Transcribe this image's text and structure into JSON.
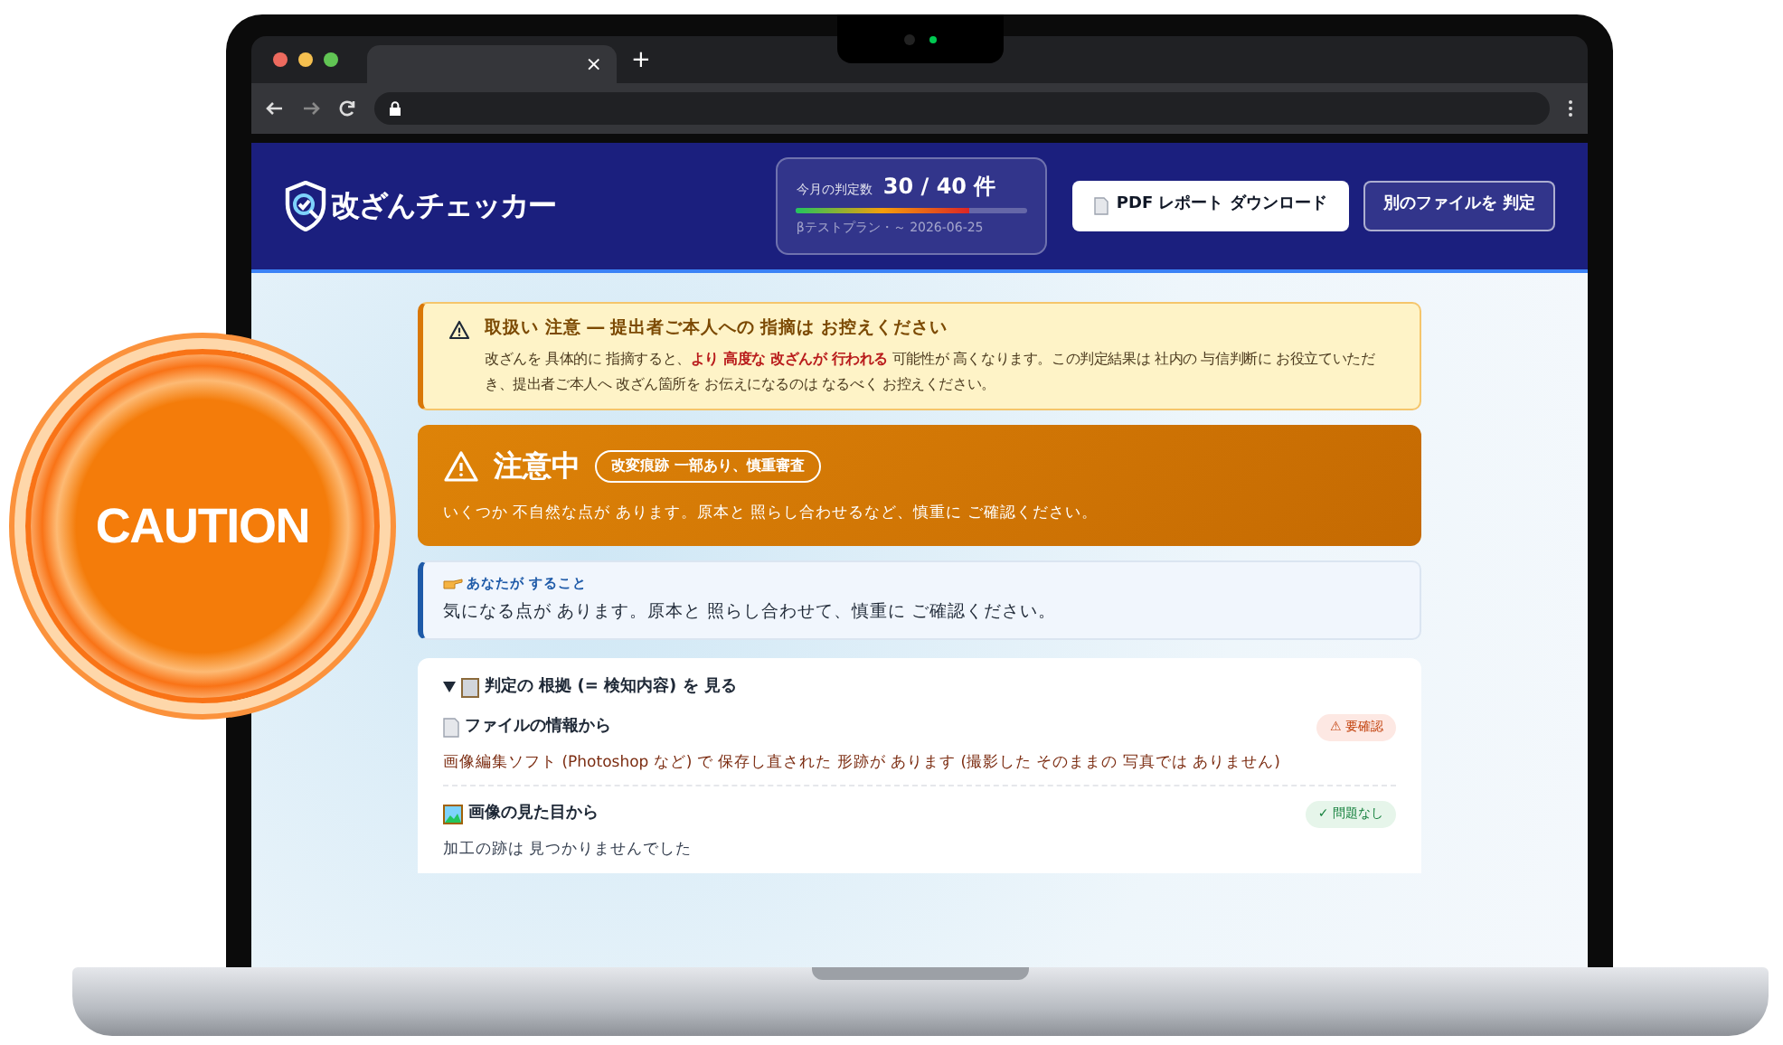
{
  "browser": {
    "tab_close": "×",
    "new_tab": "+"
  },
  "header": {
    "logo": "改ざんチェッカー",
    "usage": {
      "label": "今月の判定数",
      "count": "30 / 40 件",
      "level": 0.75,
      "plan": "βテストプラン・～ 2026-06-25"
    },
    "buttons": [
      {
        "label": "PDF レポート ダウンロード",
        "kind": "primary"
      },
      {
        "label": "別のファイルを 判定",
        "kind": "outline"
      }
    ]
  },
  "notice": {
    "title": "取扱い 注意 ― 提出者ご本人への 指摘は お控えください",
    "body": "改ざんを 具体的に 指摘すると、**より 高度な 改ざんが 行われる** 可能性が 高くなります。この判定結果は 社内の 与信判断に お役立ていただき、提出者ご本人へ 改ざん箇所を お伝えになるのは なるべく お控えください。"
  },
  "verdict": {
    "title": "注意中",
    "tag": "改変痕跡 一部あり、慎重審査",
    "message": "いくつか 不自然な点が あります。原本と 照らし合わせるなど、慎重に ご確認ください。"
  },
  "todo": {
    "label": "あなたが すること",
    "text": "気になる点が あります。原本と 照らし合わせて、慎重に ご確認ください。"
  },
  "evidence": {
    "title": "判定の 根拠 (= 検知内容) を 見る",
    "expanded": true,
    "items": [
      {
        "title": "ファイルの情報から",
        "kind": "warning",
        "badge": "⚠ 要確認",
        "detail": "画像編集ソフト (Photoshop など) で 保存し直された 形跡が あります (撮影した そのままの 写真では ありません)"
      },
      {
        "title": "画像の見た目から",
        "kind": "ok",
        "badge": "✓ 問題なし",
        "detail": "加工の跡は 見つかりませんでした"
      }
    ]
  },
  "badge": {
    "text": "CAUTION"
  }
}
